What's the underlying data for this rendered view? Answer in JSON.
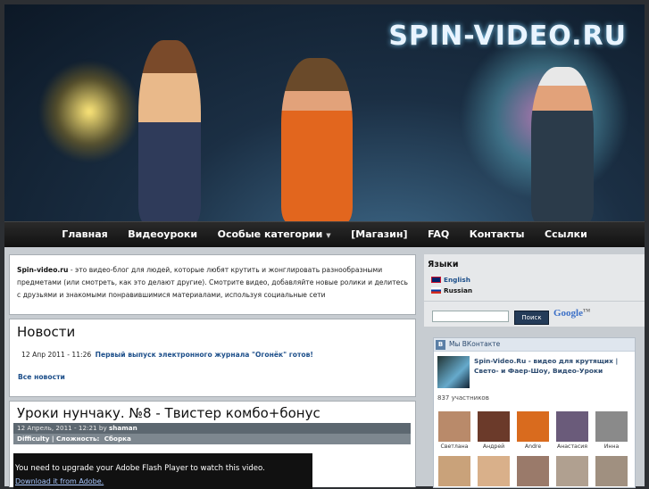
{
  "header": {
    "site_logo": "SPIN-VIDEO.RU"
  },
  "nav": {
    "items": [
      {
        "label": "Главная"
      },
      {
        "label": "Видеоуроки"
      },
      {
        "label": "Особые категории",
        "has_dropdown": true
      },
      {
        "label": "[Магазин]"
      },
      {
        "label": "FAQ"
      },
      {
        "label": "Контакты"
      },
      {
        "label": "Ссылки"
      }
    ]
  },
  "intro": {
    "site_name": "Spin-video.ru",
    "text": " - это видео-блог для людей, которые любят крутить и жонглировать разнообразными предметами (или смотреть, как это делают другие). Смотрите видео, добавляйте новые ролики и делитесь с друзьями и знакомыми понравившимися материалами, используя социальные сети"
  },
  "news": {
    "title": "Новости",
    "items": [
      {
        "date": "12 Апр 2011 - 11:26",
        "link": "Первый выпуск электронного журнала \"Огонёк\" готов!"
      }
    ],
    "all_link": "Все новости"
  },
  "post": {
    "title": "Уроки нунчаку. №8 - Твистер комбо+бонус",
    "date": "12 Апрель, 2011 - 12:21",
    "by": "by",
    "author": "shaman",
    "tag_label": "Difficulty | Сложность:",
    "tag_value": "Сборка",
    "flash_message": "You need to upgrade your Adobe Flash Player to watch this video.",
    "flash_link": "Download it from Adobe."
  },
  "sidebar": {
    "languages_title": "Языки",
    "languages": [
      {
        "label": "English"
      },
      {
        "label": "Russian"
      }
    ],
    "search_button": "Поиск",
    "google_label": "Google",
    "google_sup": "TM",
    "vk": {
      "header": "Мы ВКонтакте",
      "badge": "В",
      "group_title": "Spin-Video.Ru - видео для крутящих | Свето- и Фаер-Шоу, Видео-Уроки",
      "member_count": "837 участников",
      "members": [
        {
          "name": "Светлана",
          "color": "#b98a6a"
        },
        {
          "name": "Андрей",
          "color": "#6b3a2a"
        },
        {
          "name": "Andre",
          "color": "#d96b1e"
        },
        {
          "name": "Анастасия",
          "color": "#6a5b7a"
        },
        {
          "name": "Инна",
          "color": "#8a8a8a"
        }
      ]
    }
  },
  "colors": {
    "nav_bg": "#1a1a1a",
    "content_bg": "#c7ccd1",
    "link": "#1d4f8a",
    "post_meta_bg": "#5c6770"
  }
}
